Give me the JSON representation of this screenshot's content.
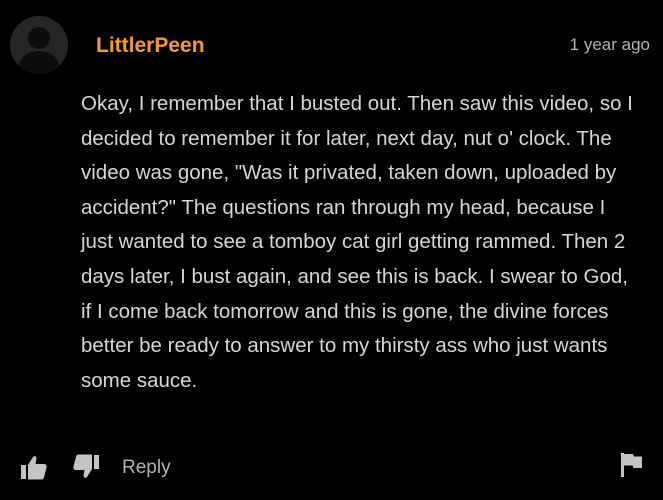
{
  "comment": {
    "username": "LittlerPeen",
    "timestamp": "1 year ago",
    "body": "Okay, I remember that I busted out. Then saw this video, so I decided to remember it for later, next day, nut o' clock. The video was gone, \"Was it privated, taken down, uploaded by accident?\" The questions ran through my head, because I just wanted to see a tomboy cat girl getting rammed. Then 2 days later, I bust again, and see this is back. I swear to God, if I come back tomorrow and this is gone, the divine forces better be ready to answer to my thirsty ass who just wants some sauce."
  },
  "actions": {
    "like_icon": "thumbs-up-icon",
    "dislike_icon": "thumbs-down-icon",
    "reply_label": "Reply",
    "flag_icon": "flag-icon"
  },
  "colors": {
    "background": "#000000",
    "username": "#f19a37",
    "body_text": "#d6d6d6",
    "muted": "#b5b5b5"
  }
}
